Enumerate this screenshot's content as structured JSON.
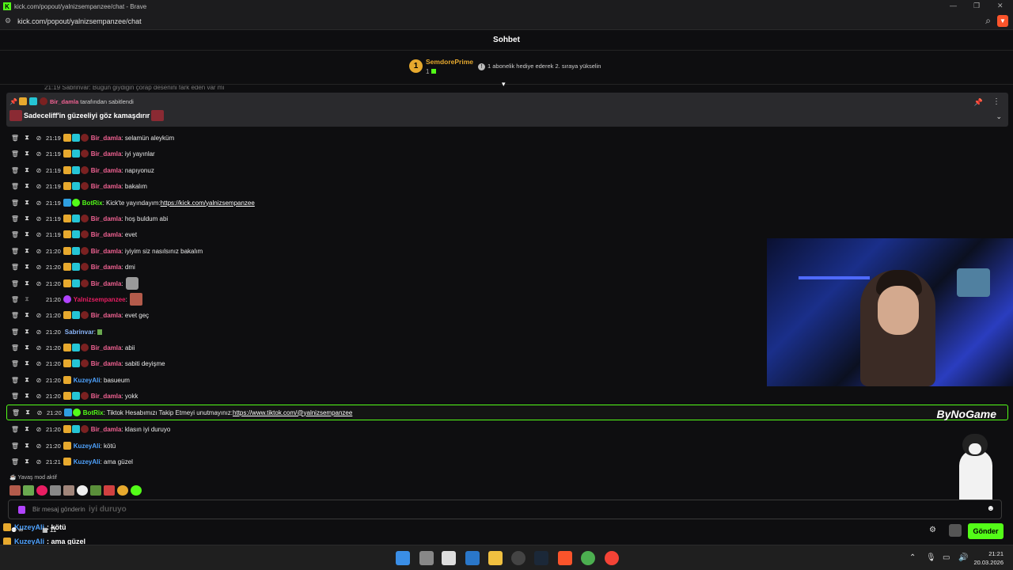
{
  "browser": {
    "title": "kick.com/popout/yalnizsempanzee/chat - Brave",
    "url": "kick.com/popout/yalnizsempanzee/chat"
  },
  "chat": {
    "header": "Sohbet",
    "leaderboard": {
      "rank": "1",
      "name": "SemdorePrime",
      "count": "1",
      "info": "1 abonelik hediye ederek 2. sıraya yükselin"
    },
    "cut_text": "21:19 Sabrinvar: Bugün giydiğin çorap desenini fark eden var mı",
    "pinned": {
      "by_user": "Bir_damla",
      "by_text": "tarafından sabitlendi",
      "message": "Sadeceliff'in güzeeliyi göz kamaşdırır"
    },
    "messages": [
      {
        "time": "21:19",
        "user": "Bir_damla",
        "text": ": selamün aleyküm"
      },
      {
        "time": "21:19",
        "user": "Bir_damla",
        "text": ": iyi yayınlar"
      },
      {
        "time": "21:19",
        "user": "Bir_damla",
        "text": ": napıyonuz"
      },
      {
        "time": "21:19",
        "user": "Bir_damla",
        "text": ": bakalım"
      },
      {
        "time": "21:19",
        "user": "BotRix",
        "text": ": Kick'te yayındayım: ",
        "link": "https://kick.com/yalnizsempanzee"
      },
      {
        "time": "21:19",
        "user": "Bir_damla",
        "text": ": hoş buldum abi"
      },
      {
        "time": "21:19",
        "user": "Bir_damla",
        "text": ": evet"
      },
      {
        "time": "21:20",
        "user": "Bir_damla",
        "text": ": iyiyim siz nasılsınız bakalım"
      },
      {
        "time": "21:20",
        "user": "Bir_damla",
        "text": ": dmi"
      },
      {
        "time": "21:20",
        "user": "Bir_damla",
        "text": ":"
      },
      {
        "time": "21:20",
        "user": "Yalnizsempanzee",
        "text": ":"
      },
      {
        "time": "21:20",
        "user": "Bir_damla",
        "text": ": evet geç"
      },
      {
        "time": "21:20",
        "user": "Sabrinvar",
        "text": ":"
      },
      {
        "time": "21:20",
        "user": "Bir_damla",
        "text": ": abii"
      },
      {
        "time": "21:20",
        "user": "Bir_damla",
        "text": ": sabiti deyişme"
      },
      {
        "time": "21:20",
        "user": "KuzeyAli",
        "text": ": basueum"
      },
      {
        "time": "21:20",
        "user": "Bir_damla",
        "text": ": yokk"
      },
      {
        "time": "21:20",
        "user": "BotRix",
        "text": ": Tiktok Hesabımızı Takip Etmeyi unutmayınız: ",
        "link": "https://www.tiktok.com/@yalnizsempanzee"
      },
      {
        "time": "21:20",
        "user": "Bir_damla",
        "text": ": klasın iyi duruyo"
      },
      {
        "time": "21:20",
        "user": "KuzeyAli",
        "text": ": kötü"
      },
      {
        "time": "21:21",
        "user": "KuzeyAli",
        "text": ": ama güzel"
      }
    ],
    "watermark": "ByNoGame",
    "slow_mode": "Yavaş mod aktif",
    "input_placeholder": "Bir mesaj gönderin",
    "ghost_text": "iyi duruyo",
    "send_label": "Gönder"
  },
  "overlay": {
    "lines": [
      {
        "user": "KuzeyAli",
        "text": ": kötü"
      },
      {
        "user": "KuzeyAli",
        "text": ": ama güzel"
      }
    ],
    "stat_a": "∞",
    "stat_b": "11"
  },
  "taskbar": {
    "time": "21:21",
    "date": "20.03.2026"
  },
  "colors": {
    "brand": "#53fc18",
    "gold": "#e7a92e",
    "background": "#0e0e10"
  }
}
